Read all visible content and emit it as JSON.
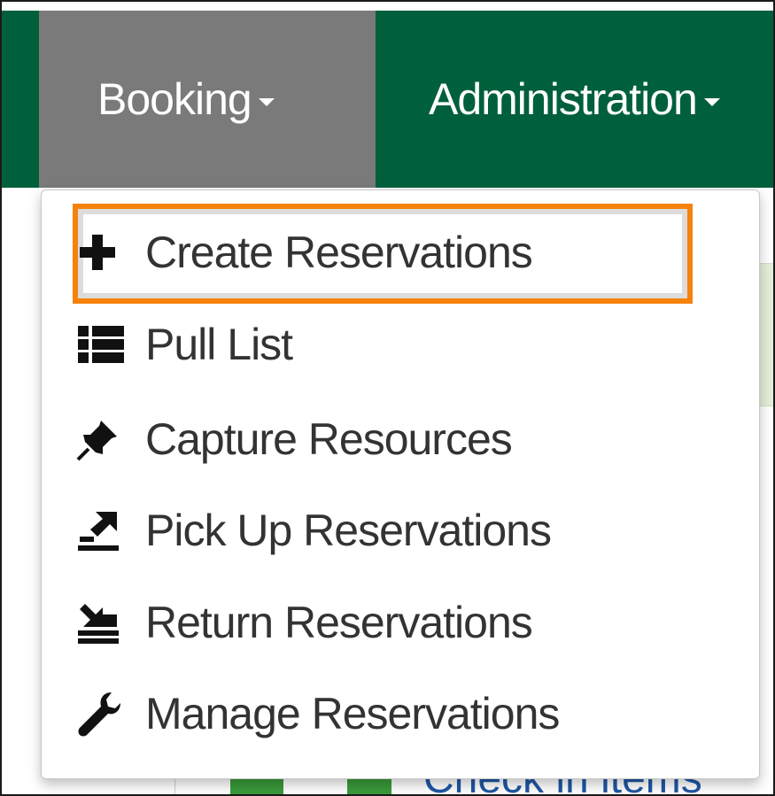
{
  "navbar": {
    "items": [
      {
        "label": "Booking",
        "active": true
      },
      {
        "label": "Administration",
        "active": false
      }
    ]
  },
  "dropdown": {
    "items": [
      {
        "icon": "plus-icon",
        "label": "Create Reservations",
        "highlighted": true
      },
      {
        "icon": "list-icon",
        "label": "Pull List"
      },
      {
        "icon": "pushpin-icon",
        "label": "Capture Resources"
      },
      {
        "icon": "pickup-icon",
        "label": "Pick Up Reservations"
      },
      {
        "icon": "return-icon",
        "label": "Return Reservations"
      },
      {
        "icon": "wrench-icon",
        "label": "Manage Reservations"
      }
    ]
  },
  "background": {
    "link_text": "Check in items"
  },
  "colors": {
    "navbar": "#00603c",
    "active_nav": "#7a7a7a",
    "highlight": "#f5820a",
    "link": "#1f57a5"
  }
}
